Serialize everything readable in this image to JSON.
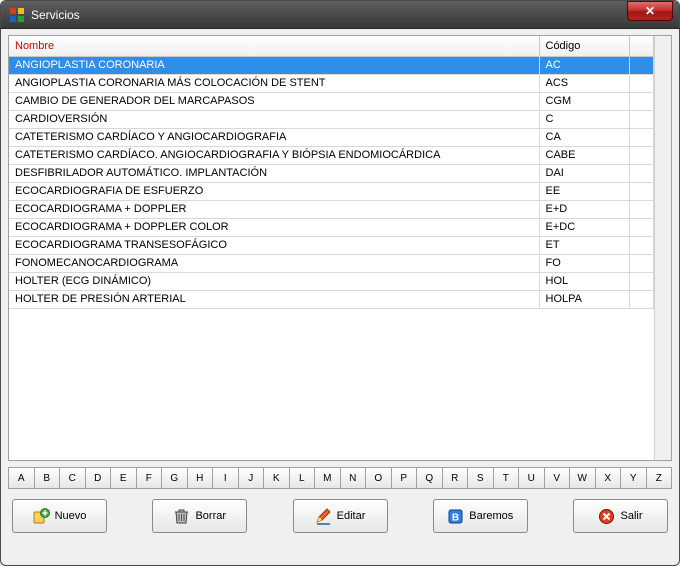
{
  "window": {
    "title": "Servicios"
  },
  "table": {
    "columns": {
      "name": "Nombre",
      "code": "Código"
    },
    "rows": [
      {
        "name": "ANGIOPLASTIA CORONARIA",
        "code": "AC",
        "selected": true
      },
      {
        "name": "ANGIOPLASTIA CORONARIA MÁS COLOCACIÓN DE STENT",
        "code": "ACS",
        "selected": false
      },
      {
        "name": "CAMBIO DE GENERADOR DEL MARCAPASOS",
        "code": "CGM",
        "selected": false
      },
      {
        "name": "CARDIOVERSIÓN",
        "code": "C",
        "selected": false
      },
      {
        "name": "CATETERISMO CARDÍACO Y ANGIOCARDIOGRAFIA",
        "code": "CA",
        "selected": false
      },
      {
        "name": "CATETERISMO CARDÍACO. ANGIOCARDIOGRAFIA Y BIÓPSIA ENDOMIOCÁRDICA",
        "code": "CABE",
        "selected": false
      },
      {
        "name": "DESFIBRILADOR AUTOMÁTICO. IMPLANTACIÓN",
        "code": "DAI",
        "selected": false
      },
      {
        "name": "ECOCARDIOGRAFIA DE ESFUERZO",
        "code": "EE",
        "selected": false
      },
      {
        "name": "ECOCARDIOGRAMA + DOPPLER",
        "code": "E+D",
        "selected": false
      },
      {
        "name": "ECOCARDIOGRAMA + DOPPLER COLOR",
        "code": "E+DC",
        "selected": false
      },
      {
        "name": "ECOCARDIOGRAMA TRANSESOFÁGICO",
        "code": "ET",
        "selected": false
      },
      {
        "name": "FONOMECANOCARDIOGRAMA",
        "code": "FO",
        "selected": false
      },
      {
        "name": "HOLTER (ECG DINÁMICO)",
        "code": "HOL",
        "selected": false
      },
      {
        "name": "HOLTER DE PRESIÓN ARTERIAL",
        "code": "HOLPA",
        "selected": false
      }
    ]
  },
  "alphabet": [
    "A",
    "B",
    "C",
    "D",
    "E",
    "F",
    "G",
    "H",
    "I",
    "J",
    "K",
    "L",
    "M",
    "N",
    "O",
    "P",
    "Q",
    "R",
    "S",
    "T",
    "U",
    "V",
    "W",
    "X",
    "Y",
    "Z"
  ],
  "buttons": {
    "nuevo": "Nuevo",
    "borrar": "Borrar",
    "editar": "Editar",
    "baremos": "Baremos",
    "salir": "Salir"
  }
}
